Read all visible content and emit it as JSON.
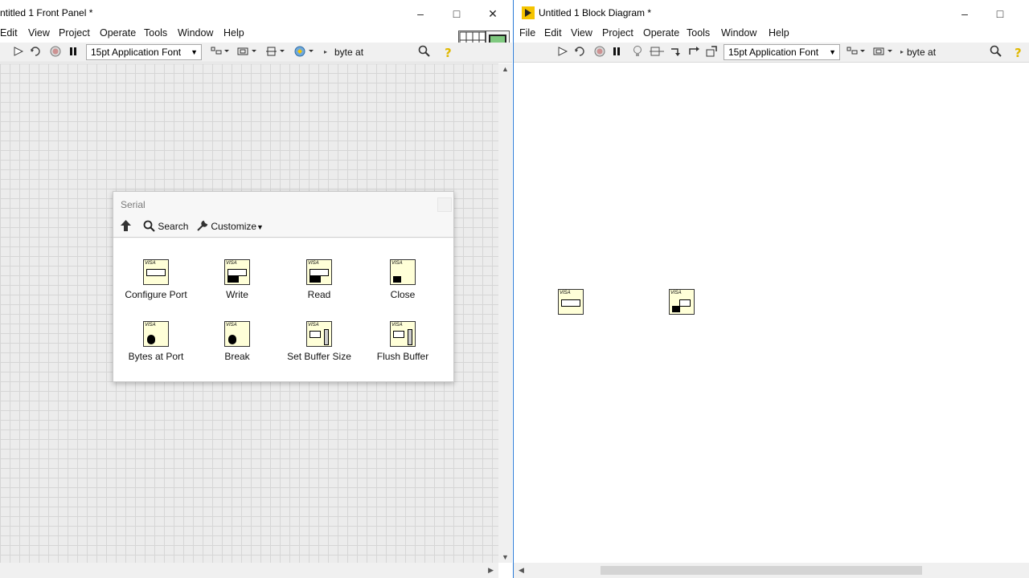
{
  "front_panel": {
    "title": "ntitled 1 Front Panel *",
    "menu": [
      "Edit",
      "View",
      "Project",
      "Operate",
      "Tools",
      "Window",
      "Help"
    ],
    "font_select": "15pt Application Font",
    "search_text": "byte at"
  },
  "block_diagram": {
    "title": "Untitled 1 Block Diagram *",
    "menu": [
      "File",
      "Edit",
      "View",
      "Project",
      "Operate",
      "Tools",
      "Window",
      "Help"
    ],
    "font_select": "15pt Application Font",
    "search_text": "byte at"
  },
  "palette": {
    "title": "Serial",
    "search_label": "Search",
    "customize_label": "Customize",
    "items": [
      {
        "label": "Configure Port",
        "icon": "visa-serial-config-icon"
      },
      {
        "label": "Write",
        "icon": "visa-write-icon"
      },
      {
        "label": "Read",
        "icon": "visa-read-icon"
      },
      {
        "label": "Close",
        "icon": "visa-close-icon"
      },
      {
        "label": "Bytes at Port",
        "icon": "visa-bytes-at-port-icon"
      },
      {
        "label": "Break",
        "icon": "visa-break-icon"
      },
      {
        "label": "Set Buffer Size",
        "icon": "visa-buffer-size-icon"
      },
      {
        "label": "Flush Buffer",
        "icon": "visa-flush-buffer-icon"
      }
    ]
  },
  "icon_header": "VISA",
  "colors": {
    "accent": "#2b7bd6",
    "vi_background": "#ffffd8",
    "run_arrow": "#444444",
    "labview_logo": "#f5c400"
  }
}
